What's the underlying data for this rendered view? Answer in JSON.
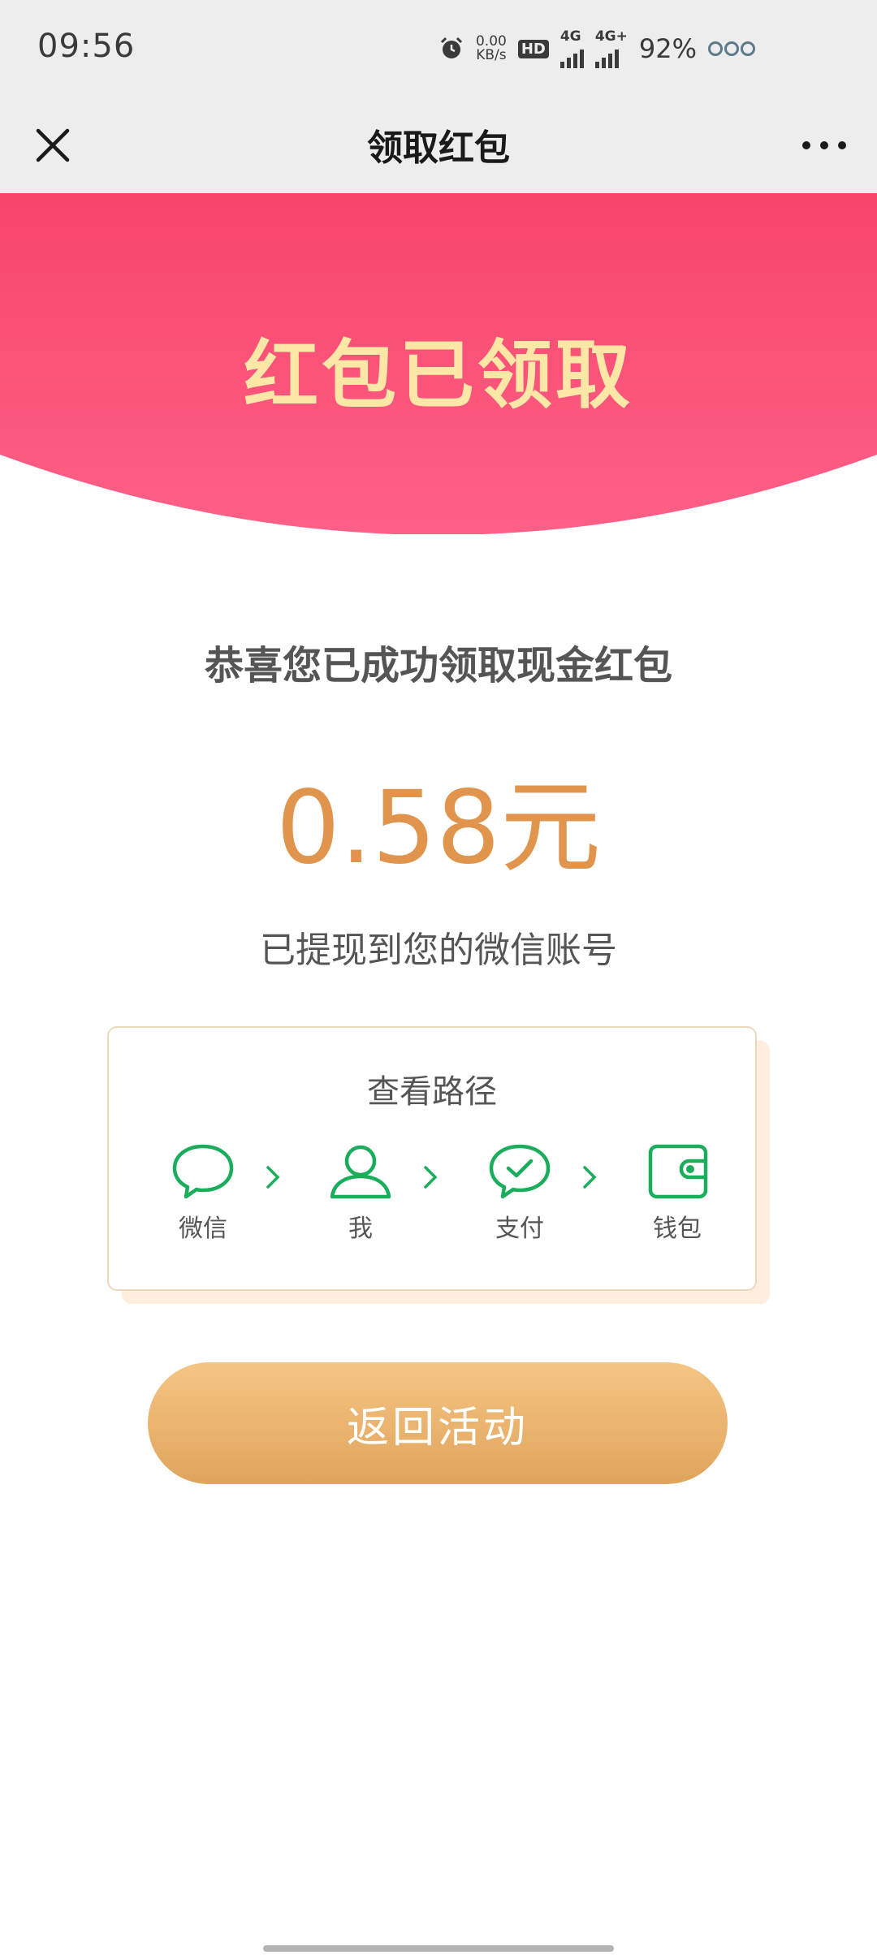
{
  "status_bar": {
    "time": "09:56",
    "net_speed_value": "0.00",
    "net_speed_unit": "KB/s",
    "hd_label": "HD",
    "sim1_label": "4G",
    "sim2_label": "4G+",
    "battery": "92%"
  },
  "nav": {
    "title": "领取红包"
  },
  "banner": {
    "title": "红包已领取"
  },
  "content": {
    "congrats": "恭喜您已成功领取现金红包",
    "amount": "0.58元",
    "withdrawn": "已提现到您的微信账号"
  },
  "path_card": {
    "title": "查看路径",
    "steps": [
      {
        "label": "微信",
        "icon": "chat-bubble-icon"
      },
      {
        "label": "我",
        "icon": "person-icon"
      },
      {
        "label": "支付",
        "icon": "check-bubble-icon"
      },
      {
        "label": "钱包",
        "icon": "wallet-icon"
      }
    ]
  },
  "actions": {
    "back_label": "返回活动"
  },
  "colors": {
    "banner_top": "#f7456a",
    "banner_bottom": "#ff6088",
    "amount": "#e0944c",
    "icon_green": "#1aad5c",
    "button_top": "#f5c584",
    "button_bottom": "#e0a45c"
  }
}
